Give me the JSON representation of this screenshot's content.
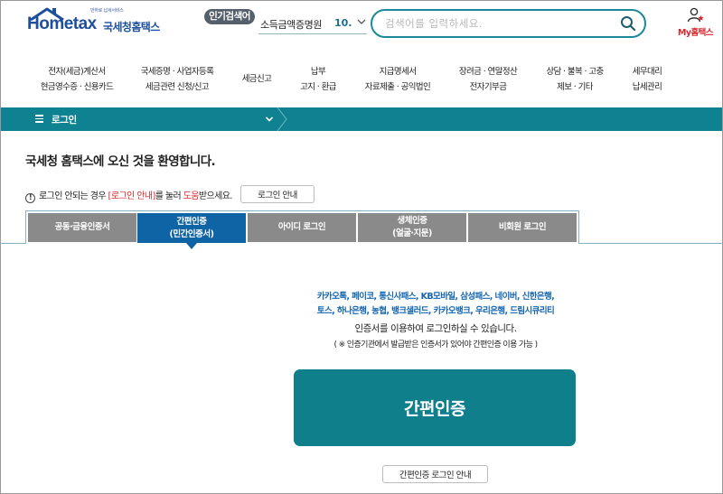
{
  "header": {
    "logo_tagline": "만하로 납세서비스",
    "logo_text": "Hometax",
    "logo_korean": "국세청홈택스",
    "popular_badge": "인기검색어",
    "popular_item": "소득금액증명원",
    "popular_rank": "10.",
    "search_placeholder": "검색어를 입력하세요.",
    "my_label": "My홈택스"
  },
  "nav": [
    {
      "line1": "전자(세금)계산서",
      "line2": "현금영수증 · 신용카드"
    },
    {
      "line1": "국세증명 · 사업자등록",
      "line2": "세금관련 신청/신고"
    },
    {
      "line1": "세금신고",
      "line2": ""
    },
    {
      "line1": "납부",
      "line2": "고지 · 환급"
    },
    {
      "line1": "지급명세서",
      "line2": "자료제출 · 공익법인"
    },
    {
      "line1": "장려금 · 연말정산",
      "line2": "전자기부금"
    },
    {
      "line1": "상담 · 불복 · 고충",
      "line2": "제보 · 기타"
    },
    {
      "line1": "세무대리",
      "line2": "납세관리"
    }
  ],
  "breadcrumb": "로그인",
  "welcome": "국세청 홈택스에 오신 것을 환영합니다.",
  "notice": {
    "pre": "로그인 안되는 경우 ",
    "link": "[로그인 안내]",
    "mid": "를 눌러 ",
    "help": "도움",
    "post": "받으세요.",
    "button": "로그인 안내"
  },
  "tabs": [
    {
      "line1": "공동·금융인증서",
      "line2": ""
    },
    {
      "line1": "간편인증",
      "line2": "(민간인증서)"
    },
    {
      "line1": "아이디 로그인",
      "line2": ""
    },
    {
      "line1": "생체인증",
      "line2": "(얼굴·지문)"
    },
    {
      "line1": "비회원 로그인",
      "line2": ""
    }
  ],
  "providers_line1": "카카오톡, 페이코, 통신사패스, KB모바일, 삼성패스, 네이버, 신한은행,",
  "providers_line2": "토스, 하나은행, 농협, 뱅크샐러드, 카카오뱅크, 우리은행, 드림시큐리티",
  "use_text": "인증서를 이용하여 로그인하실 수 있습니다.",
  "sub_text": "( ※ 인증기관에서 발급받은 인증서가 있어야 간편인증 이용 가능 )",
  "main_button": "간편인증",
  "guide_button": "간편인증 로그인 안내",
  "colors": {
    "teal": "#0f8291",
    "active_tab": "#0f64a6",
    "inactive_tab": "#8a8a8a",
    "accent_red": "#d8282e",
    "provider_blue": "#1566b0"
  }
}
